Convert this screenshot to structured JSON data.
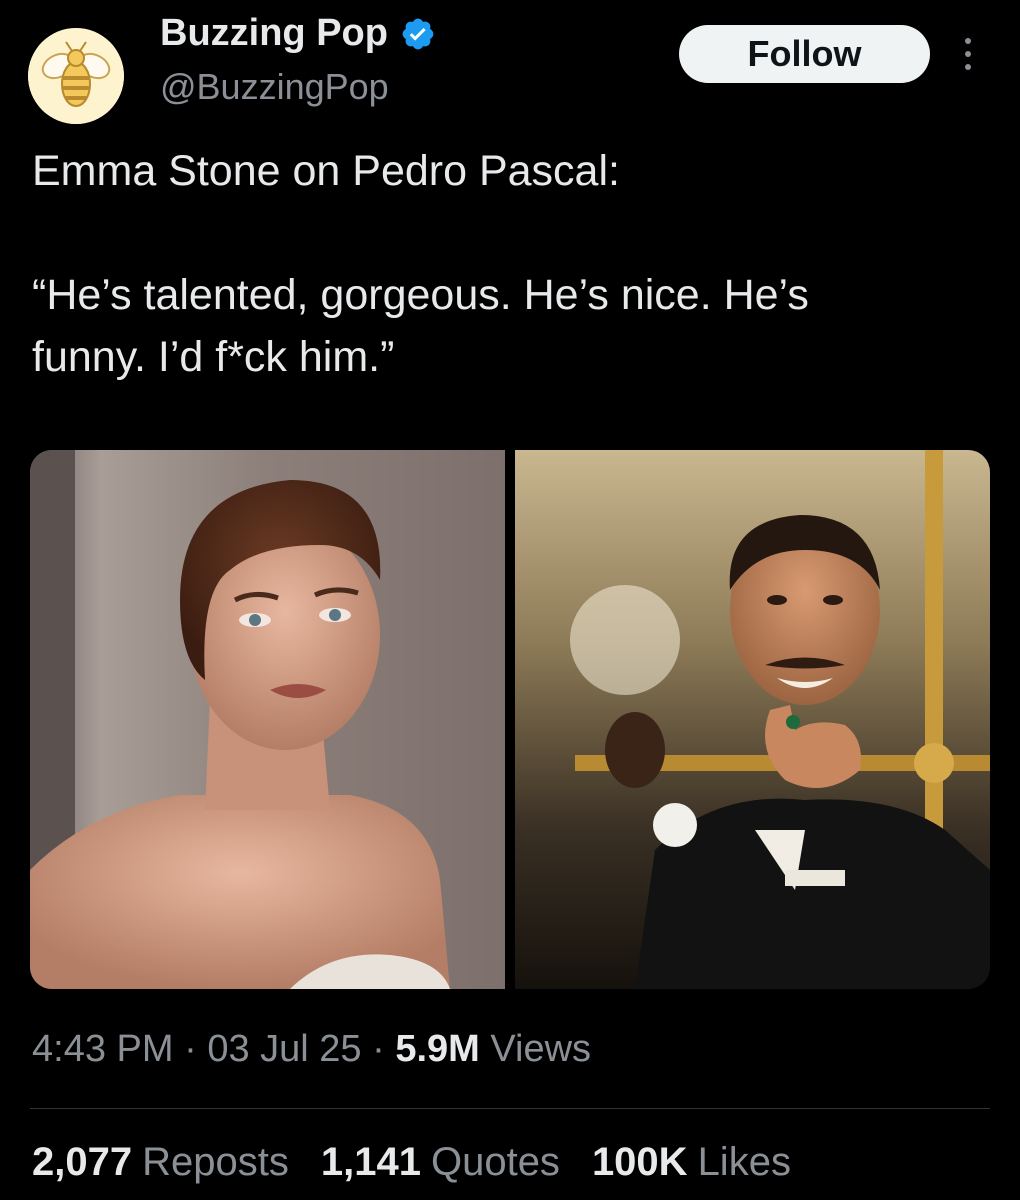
{
  "colors": {
    "background": "#000000",
    "primary_text": "#e7e9ea",
    "secondary_text": "#8b9096",
    "verified_badge": "#1d9bf0",
    "follow_button_bg": "#eff3f4",
    "divider": "#2f3336"
  },
  "author": {
    "avatar_icon": "bee-icon",
    "display_name": "Buzzing Pop",
    "verified_icon": "verified-badge-icon",
    "handle": "@BuzzingPop"
  },
  "header": {
    "follow_label": "Follow",
    "more_icon": "more-vertical-icon"
  },
  "tweet": {
    "line1": "Emma Stone on Pedro Pascal:",
    "line2": "“He’s talented, gorgeous. He’s nice. He’s",
    "line3": "funny. I’d f*ck him.”"
  },
  "media": {
    "count": 2
  },
  "meta": {
    "time": "4:43 PM",
    "sep1": " · ",
    "date": "03 Jul 25",
    "sep2": " · ",
    "views_count": "5.9M",
    "views_label": " Views"
  },
  "stats": {
    "reposts_count": "2,077",
    "reposts_label": "Reposts",
    "quotes_count": "1,141",
    "quotes_label": "Quotes",
    "likes_count": "100K",
    "likes_label": "Likes"
  }
}
